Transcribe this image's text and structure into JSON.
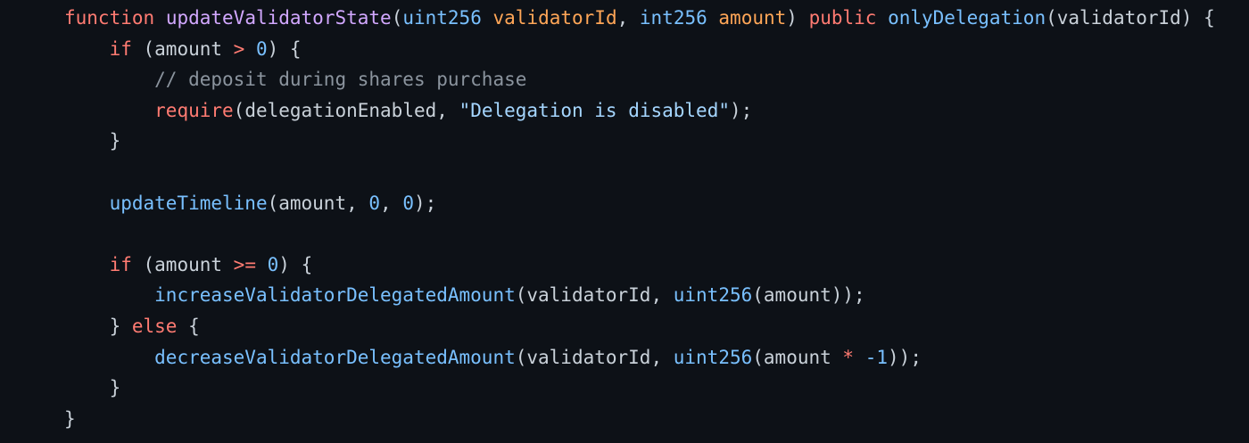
{
  "theme": {
    "background": "#0d1117",
    "text": "#c9d1d9",
    "keyword": "#ff7b72",
    "function_name": "#d2a8ff",
    "type": "#79c0ff",
    "parameter": "#ffa657",
    "number": "#79c0ff",
    "string": "#a5d6ff",
    "comment": "#8b949e",
    "call": "#79c0ff"
  },
  "code": {
    "language": "solidity",
    "lines": [
      [
        {
          "t": "function",
          "k": "kw"
        },
        {
          "t": " ",
          "k": "pn"
        },
        {
          "t": "updateValidatorState",
          "k": "fn"
        },
        {
          "t": "(",
          "k": "pn"
        },
        {
          "t": "uint256",
          "k": "ty"
        },
        {
          "t": " ",
          "k": "pn"
        },
        {
          "t": "validatorId",
          "k": "prm"
        },
        {
          "t": ", ",
          "k": "pn"
        },
        {
          "t": "int256",
          "k": "ty"
        },
        {
          "t": " ",
          "k": "pn"
        },
        {
          "t": "amount",
          "k": "prm"
        },
        {
          "t": ") ",
          "k": "pn"
        },
        {
          "t": "public",
          "k": "kw"
        },
        {
          "t": " ",
          "k": "pn"
        },
        {
          "t": "onlyDelegation",
          "k": "mod"
        },
        {
          "t": "(validatorId) {",
          "k": "pn"
        }
      ],
      [
        {
          "t": "    ",
          "k": "pn"
        },
        {
          "t": "if",
          "k": "kw"
        },
        {
          "t": " (amount ",
          "k": "pn"
        },
        {
          "t": ">",
          "k": "op"
        },
        {
          "t": " ",
          "k": "pn"
        },
        {
          "t": "0",
          "k": "num"
        },
        {
          "t": ") {",
          "k": "pn"
        }
      ],
      [
        {
          "t": "        ",
          "k": "pn"
        },
        {
          "t": "// deposit during shares purchase",
          "k": "com"
        }
      ],
      [
        {
          "t": "        ",
          "k": "pn"
        },
        {
          "t": "require",
          "k": "kw"
        },
        {
          "t": "(delegationEnabled, ",
          "k": "pn"
        },
        {
          "t": "\"Delegation is disabled\"",
          "k": "str"
        },
        {
          "t": ");",
          "k": "pn"
        }
      ],
      [
        {
          "t": "    }",
          "k": "pn"
        }
      ],
      [],
      [
        {
          "t": "    ",
          "k": "pn"
        },
        {
          "t": "updateTimeline",
          "k": "call"
        },
        {
          "t": "(amount, ",
          "k": "pn"
        },
        {
          "t": "0",
          "k": "num"
        },
        {
          "t": ", ",
          "k": "pn"
        },
        {
          "t": "0",
          "k": "num"
        },
        {
          "t": ");",
          "k": "pn"
        }
      ],
      [],
      [
        {
          "t": "    ",
          "k": "pn"
        },
        {
          "t": "if",
          "k": "kw"
        },
        {
          "t": " (amount ",
          "k": "pn"
        },
        {
          "t": ">=",
          "k": "op"
        },
        {
          "t": " ",
          "k": "pn"
        },
        {
          "t": "0",
          "k": "num"
        },
        {
          "t": ") {",
          "k": "pn"
        }
      ],
      [
        {
          "t": "        ",
          "k": "pn"
        },
        {
          "t": "increaseValidatorDelegatedAmount",
          "k": "call"
        },
        {
          "t": "(validatorId, ",
          "k": "pn"
        },
        {
          "t": "uint256",
          "k": "ty"
        },
        {
          "t": "(amount));",
          "k": "pn"
        }
      ],
      [
        {
          "t": "    } ",
          "k": "pn"
        },
        {
          "t": "else",
          "k": "kw"
        },
        {
          "t": " {",
          "k": "pn"
        }
      ],
      [
        {
          "t": "        ",
          "k": "pn"
        },
        {
          "t": "decreaseValidatorDelegatedAmount",
          "k": "call"
        },
        {
          "t": "(validatorId, ",
          "k": "pn"
        },
        {
          "t": "uint256",
          "k": "ty"
        },
        {
          "t": "(amount ",
          "k": "pn"
        },
        {
          "t": "*",
          "k": "op"
        },
        {
          "t": " ",
          "k": "pn"
        },
        {
          "t": "-1",
          "k": "num"
        },
        {
          "t": "));",
          "k": "pn"
        }
      ],
      [
        {
          "t": "    }",
          "k": "pn"
        }
      ],
      [
        {
          "t": "}",
          "k": "pn"
        }
      ]
    ]
  }
}
